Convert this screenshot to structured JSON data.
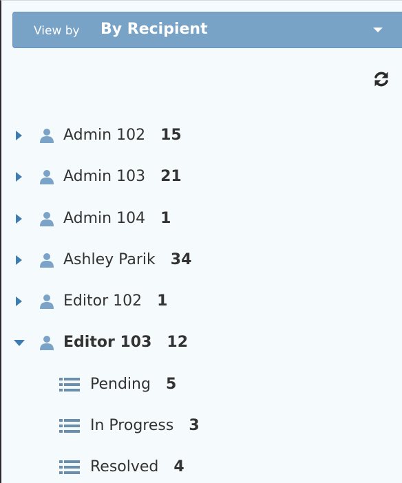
{
  "view_by": {
    "prefix": "View by",
    "value": "By Recipient"
  },
  "recipients": [
    {
      "name": "Admin 102",
      "count": "15",
      "expanded": false
    },
    {
      "name": "Admin 103",
      "count": "21",
      "expanded": false
    },
    {
      "name": "Admin 104",
      "count": "1",
      "expanded": false
    },
    {
      "name": "Ashley Parik",
      "count": "34",
      "expanded": false
    },
    {
      "name": "Editor 102",
      "count": "1",
      "expanded": false
    },
    {
      "name": "Editor 103",
      "count": "12",
      "expanded": true
    }
  ],
  "statuses": [
    {
      "name": "Pending",
      "count": "5"
    },
    {
      "name": "In Progress",
      "count": "3"
    },
    {
      "name": "Resolved",
      "count": "4"
    }
  ],
  "colors": {
    "header_bar": "#78a2c6",
    "toggle_arrow": "#3f7db0",
    "user_icon": "#7ba3c8",
    "list_icon": "#6a8fae",
    "text": "#333333",
    "panel_background": "#f5fafc"
  },
  "icons": {
    "dropdown": "caret-down-icon",
    "refresh": "refresh-icon",
    "collapsed": "caret-right-icon",
    "expanded": "caret-down-icon",
    "recipient": "user-icon",
    "status": "list-icon"
  }
}
